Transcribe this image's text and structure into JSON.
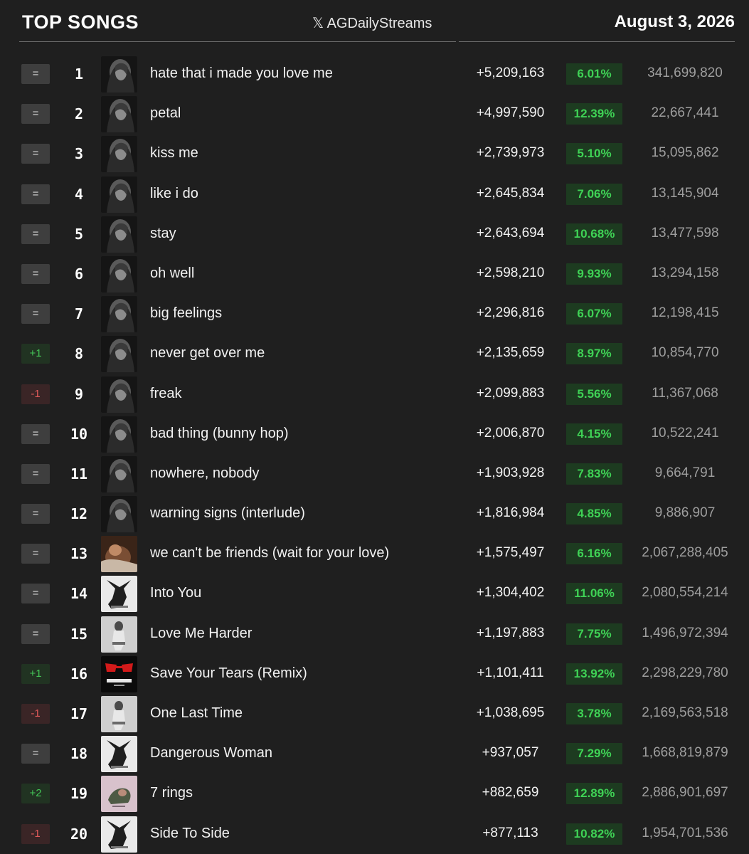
{
  "header": {
    "title": "TOP SONGS",
    "handle": "𝕏 AGDailyStreams",
    "date": "August 3, 2026"
  },
  "colors": {
    "background": "#1f1f1f",
    "percent_text": "#3fd255",
    "percent_bg": "#1d3b20",
    "up": "#44c456",
    "down": "#e05a5a"
  },
  "rows": [
    {
      "change": "=",
      "rank": "1",
      "title": "hate that i made you love me",
      "daily": "+5,209,163",
      "pct": "6.01%",
      "total": "341,699,820",
      "art": "eternal-sunshine-deluxe"
    },
    {
      "change": "=",
      "rank": "2",
      "title": "petal",
      "daily": "+4,997,590",
      "pct": "12.39%",
      "total": "22,667,441",
      "art": "eternal-sunshine-deluxe"
    },
    {
      "change": "=",
      "rank": "3",
      "title": "kiss me",
      "daily": "+2,739,973",
      "pct": "5.10%",
      "total": "15,095,862",
      "art": "eternal-sunshine-deluxe"
    },
    {
      "change": "=",
      "rank": "4",
      "title": "like i do",
      "daily": "+2,645,834",
      "pct": "7.06%",
      "total": "13,145,904",
      "art": "eternal-sunshine-deluxe"
    },
    {
      "change": "=",
      "rank": "5",
      "title": "stay",
      "daily": "+2,643,694",
      "pct": "10.68%",
      "total": "13,477,598",
      "art": "eternal-sunshine-deluxe"
    },
    {
      "change": "=",
      "rank": "6",
      "title": "oh well",
      "daily": "+2,598,210",
      "pct": "9.93%",
      "total": "13,294,158",
      "art": "eternal-sunshine-deluxe"
    },
    {
      "change": "=",
      "rank": "7",
      "title": "big feelings",
      "daily": "+2,296,816",
      "pct": "6.07%",
      "total": "12,198,415",
      "art": "eternal-sunshine-deluxe"
    },
    {
      "change": "+1",
      "rank": "8",
      "title": "never get over me",
      "daily": "+2,135,659",
      "pct": "8.97%",
      "total": "10,854,770",
      "art": "eternal-sunshine-deluxe"
    },
    {
      "change": "-1",
      "rank": "9",
      "title": "freak",
      "daily": "+2,099,883",
      "pct": "5.56%",
      "total": "11,367,068",
      "art": "eternal-sunshine-deluxe"
    },
    {
      "change": "=",
      "rank": "10",
      "title": "bad thing (bunny hop)",
      "daily": "+2,006,870",
      "pct": "4.15%",
      "total": "10,522,241",
      "art": "eternal-sunshine-deluxe"
    },
    {
      "change": "=",
      "rank": "11",
      "title": "nowhere, nobody",
      "daily": "+1,903,928",
      "pct": "7.83%",
      "total": "9,664,791",
      "art": "eternal-sunshine-deluxe"
    },
    {
      "change": "=",
      "rank": "12",
      "title": "warning signs (interlude)",
      "daily": "+1,816,984",
      "pct": "4.85%",
      "total": "9,886,907",
      "art": "eternal-sunshine-deluxe"
    },
    {
      "change": "=",
      "rank": "13",
      "title": "we can't be friends (wait for your love)",
      "daily": "+1,575,497",
      "pct": "6.16%",
      "total": "2,067,288,405",
      "art": "eternal-sunshine"
    },
    {
      "change": "=",
      "rank": "14",
      "title": "Into You",
      "daily": "+1,304,402",
      "pct": "11.06%",
      "total": "2,080,554,214",
      "art": "dangerous-woman"
    },
    {
      "change": "=",
      "rank": "15",
      "title": "Love Me Harder",
      "daily": "+1,197,883",
      "pct": "7.75%",
      "total": "1,496,972,394",
      "art": "my-everything"
    },
    {
      "change": "+1",
      "rank": "16",
      "title": "Save Your Tears (Remix)",
      "daily": "+1,101,411",
      "pct": "13.92%",
      "total": "2,298,229,780",
      "art": "save-your-tears"
    },
    {
      "change": "-1",
      "rank": "17",
      "title": "One Last Time",
      "daily": "+1,038,695",
      "pct": "3.78%",
      "total": "2,169,563,518",
      "art": "my-everything"
    },
    {
      "change": "=",
      "rank": "18",
      "title": "Dangerous Woman",
      "daily": "+937,057",
      "pct": "7.29%",
      "total": "1,668,819,879",
      "art": "dangerous-woman"
    },
    {
      "change": "+2",
      "rank": "19",
      "title": "7 rings",
      "daily": "+882,659",
      "pct": "12.89%",
      "total": "2,886,901,697",
      "art": "thank-u-next"
    },
    {
      "change": "-1",
      "rank": "20",
      "title": "Side To Side",
      "daily": "+877,113",
      "pct": "10.82%",
      "total": "1,954,701,536",
      "art": "dangerous-woman"
    }
  ]
}
